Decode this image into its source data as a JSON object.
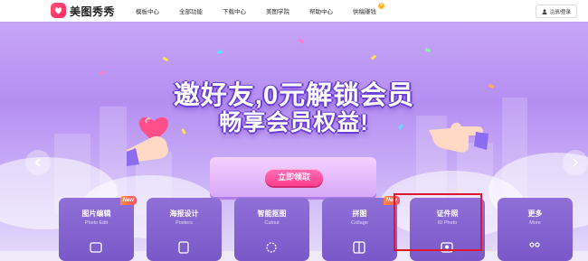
{
  "app": {
    "name": "美图秀秀"
  },
  "nav": {
    "items": [
      {
        "label": "模板中心"
      },
      {
        "label": "全部功能"
      },
      {
        "label": "下载中心"
      },
      {
        "label": "美图学院"
      },
      {
        "label": "帮助中心"
      },
      {
        "label": "供稿赚钱"
      }
    ]
  },
  "header": {
    "login_label": "注册/登录"
  },
  "banner": {
    "headline_line1": "邀好友,0元解锁会员",
    "headline_line2": "畅享会员权益!",
    "cta_label": "立即领取"
  },
  "tools": [
    {
      "title": "图片编辑",
      "subtitle": "Photo Edit",
      "badge": "New",
      "icon": "image-edit-icon"
    },
    {
      "title": "海报设计",
      "subtitle": "Posters",
      "badge": "",
      "icon": "poster-icon"
    },
    {
      "title": "智能抠图",
      "subtitle": "Cutout",
      "badge": "",
      "icon": "cutout-icon"
    },
    {
      "title": "拼图",
      "subtitle": "Collage",
      "badge": "New",
      "icon": "collage-icon"
    },
    {
      "title": "证件照",
      "subtitle": "ID Photo",
      "badge": "",
      "icon": "id-photo-icon"
    },
    {
      "title": "更多",
      "subtitle": "More",
      "badge": "",
      "icon": "more-icon"
    }
  ],
  "colors": {
    "brand": "#ff2a5c",
    "banner_purple": "#b58ef2",
    "card_purple": "#8a6ad4",
    "cta_pink": "#ff4f9a",
    "highlight_red": "#e0182d"
  }
}
